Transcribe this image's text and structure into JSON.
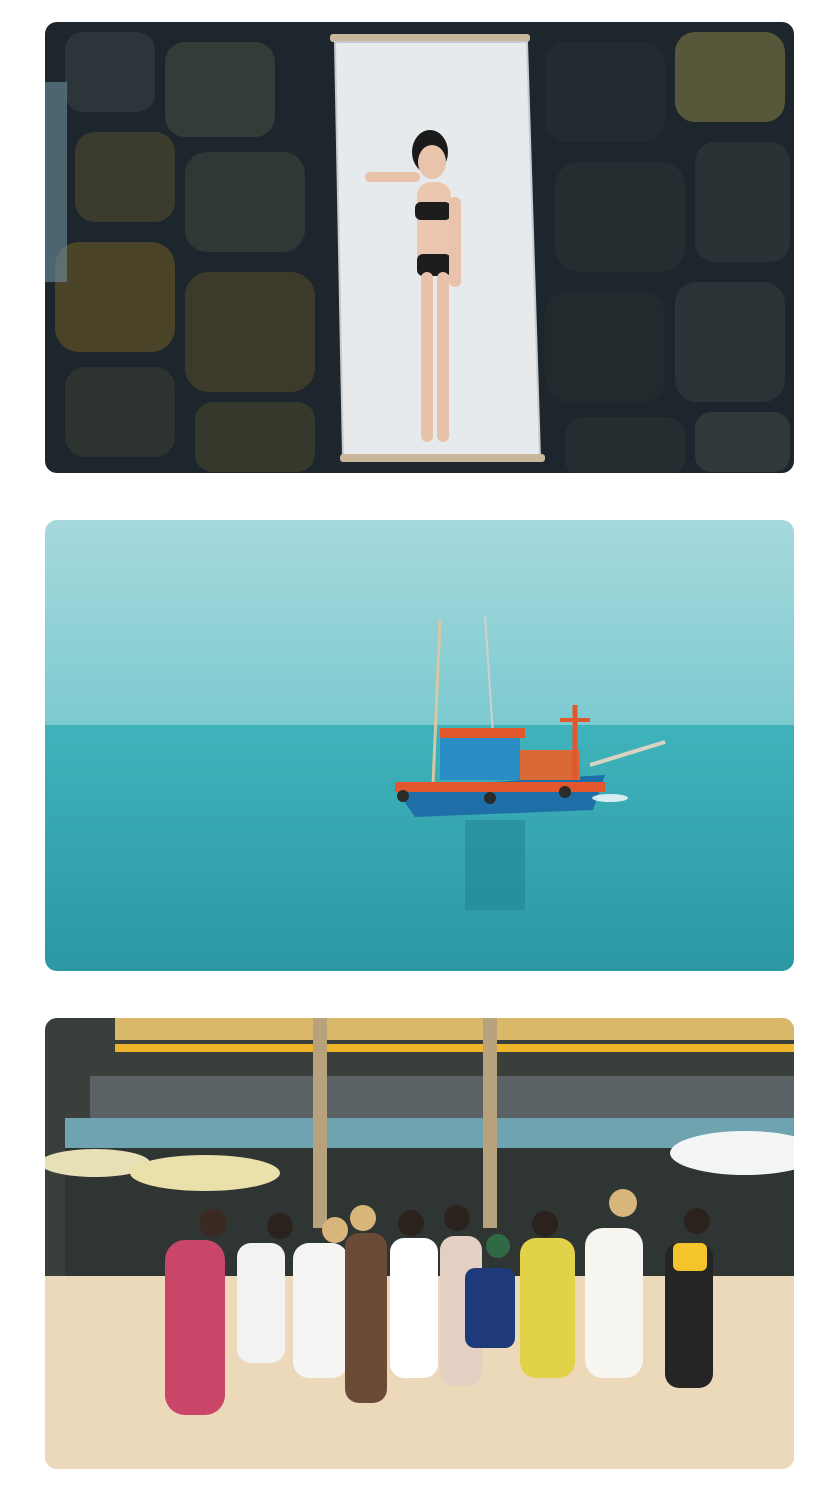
{
  "gallery": {
    "photos": [
      {
        "subject": "woman-on-hammock-over-rocks"
      },
      {
        "subject": "fishing-boat-on-sea"
      },
      {
        "subject": "group-on-beach"
      }
    ]
  },
  "colors": {
    "background": "#ffffff",
    "rock_dark": "#1f2a30",
    "rock_moss": "#4a4328",
    "hammock": "#e8ecee",
    "sky": "#8ccfd4",
    "sea": "#3aa9b3",
    "boat_hull": "#1e6fa8",
    "boat_trim": "#e2572b",
    "sand": "#e9d5b5",
    "building_roof": "#3b3f3c"
  }
}
